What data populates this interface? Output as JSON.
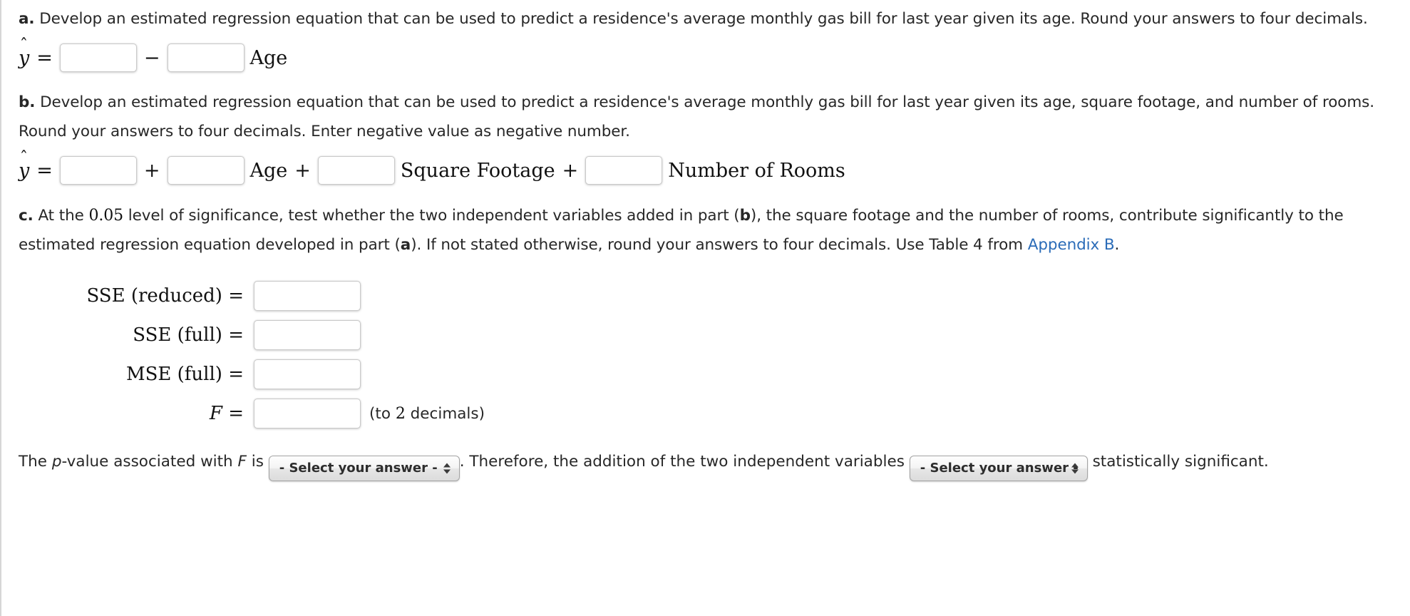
{
  "question": {
    "part_a": {
      "label": "a.",
      "text": "Develop an estimated regression equation that can be used to predict a residence's average monthly gas bill for last year given its age. Round your answers to four decimals.",
      "equation": {
        "lhs": "ŷ",
        "equals": "=",
        "operator": "−",
        "term1_label": "Age",
        "input1_value": "",
        "input2_value": "",
        "input_placeholder": ""
      }
    },
    "part_b": {
      "label": "b.",
      "text": "Develop an estimated regression equation that can be used to predict a residence's average monthly gas bill for last year given its age, square footage, and number of rooms. Round your answers to four decimals. Enter negative value as negative number.",
      "equation": {
        "lhs": "ŷ",
        "equals": "=",
        "op1": "+",
        "op2": "+",
        "op3": "+",
        "term1_label": "Age",
        "term2_label": "Square Footage",
        "term3_label": "Number of Rooms",
        "input0_value": "",
        "input1_value": "",
        "input2_value": "",
        "input3_value": ""
      }
    },
    "part_c": {
      "label": "c.",
      "text_1": "At the ",
      "alpha": "0.05",
      "text_2": " level of significance, test whether the two independent variables added in part (",
      "ref_b": "b",
      "text_3": "), the square footage and the number of rooms, contribute significantly to the estimated regression equation developed in part (",
      "ref_a": "a",
      "text_4": "). If not stated otherwise, round your answers to four decimals. Use Table 4 from ",
      "link_text": "Appendix B",
      "text_5": "."
    }
  },
  "stats": {
    "rows": [
      {
        "label": "SSE (reduced) =",
        "value": "",
        "note": ""
      },
      {
        "label": "SSE (full) =",
        "value": "",
        "note": ""
      },
      {
        "label": "MSE (full) =",
        "value": "",
        "note": ""
      },
      {
        "label": "F =",
        "value": "",
        "note_pre": "(to ",
        "note_num": "2",
        "note_post": " decimals)"
      }
    ]
  },
  "conclusion": {
    "text_1": "The ",
    "p_italic": "p",
    "text_2": "-value associated with ",
    "f_italic": "F",
    "text_3": " is ",
    "select_1": "- Select your answer -",
    "text_4": ". Therefore, the addition of the two independent variables ",
    "select_2": "- Select your answer -",
    "text_5": " statistically significant."
  },
  "colors": {
    "link": "#2b6cb8",
    "text": "#272727",
    "border": "#d6d6d6",
    "input_border": "#c9c9c9",
    "select_border": "#a3a3a3"
  }
}
